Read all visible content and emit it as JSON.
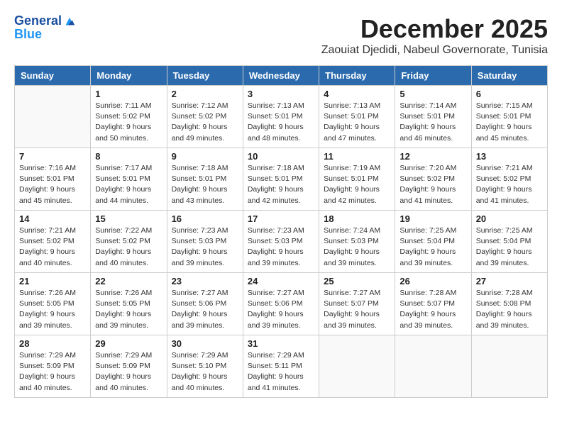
{
  "logo": {
    "general": "General",
    "blue": "Blue"
  },
  "header": {
    "month_year": "December 2025",
    "location": "Zaouiat Djedidi, Nabeul Governorate, Tunisia"
  },
  "columns": [
    "Sunday",
    "Monday",
    "Tuesday",
    "Wednesday",
    "Thursday",
    "Friday",
    "Saturday"
  ],
  "weeks": [
    [
      {
        "day": "",
        "sunrise": "",
        "sunset": "",
        "daylight": ""
      },
      {
        "day": "1",
        "sunrise": "Sunrise: 7:11 AM",
        "sunset": "Sunset: 5:02 PM",
        "daylight": "Daylight: 9 hours and 50 minutes."
      },
      {
        "day": "2",
        "sunrise": "Sunrise: 7:12 AM",
        "sunset": "Sunset: 5:02 PM",
        "daylight": "Daylight: 9 hours and 49 minutes."
      },
      {
        "day": "3",
        "sunrise": "Sunrise: 7:13 AM",
        "sunset": "Sunset: 5:01 PM",
        "daylight": "Daylight: 9 hours and 48 minutes."
      },
      {
        "day": "4",
        "sunrise": "Sunrise: 7:13 AM",
        "sunset": "Sunset: 5:01 PM",
        "daylight": "Daylight: 9 hours and 47 minutes."
      },
      {
        "day": "5",
        "sunrise": "Sunrise: 7:14 AM",
        "sunset": "Sunset: 5:01 PM",
        "daylight": "Daylight: 9 hours and 46 minutes."
      },
      {
        "day": "6",
        "sunrise": "Sunrise: 7:15 AM",
        "sunset": "Sunset: 5:01 PM",
        "daylight": "Daylight: 9 hours and 45 minutes."
      }
    ],
    [
      {
        "day": "7",
        "sunrise": "Sunrise: 7:16 AM",
        "sunset": "Sunset: 5:01 PM",
        "daylight": "Daylight: 9 hours and 45 minutes."
      },
      {
        "day": "8",
        "sunrise": "Sunrise: 7:17 AM",
        "sunset": "Sunset: 5:01 PM",
        "daylight": "Daylight: 9 hours and 44 minutes."
      },
      {
        "day": "9",
        "sunrise": "Sunrise: 7:18 AM",
        "sunset": "Sunset: 5:01 PM",
        "daylight": "Daylight: 9 hours and 43 minutes."
      },
      {
        "day": "10",
        "sunrise": "Sunrise: 7:18 AM",
        "sunset": "Sunset: 5:01 PM",
        "daylight": "Daylight: 9 hours and 42 minutes."
      },
      {
        "day": "11",
        "sunrise": "Sunrise: 7:19 AM",
        "sunset": "Sunset: 5:01 PM",
        "daylight": "Daylight: 9 hours and 42 minutes."
      },
      {
        "day": "12",
        "sunrise": "Sunrise: 7:20 AM",
        "sunset": "Sunset: 5:02 PM",
        "daylight": "Daylight: 9 hours and 41 minutes."
      },
      {
        "day": "13",
        "sunrise": "Sunrise: 7:21 AM",
        "sunset": "Sunset: 5:02 PM",
        "daylight": "Daylight: 9 hours and 41 minutes."
      }
    ],
    [
      {
        "day": "14",
        "sunrise": "Sunrise: 7:21 AM",
        "sunset": "Sunset: 5:02 PM",
        "daylight": "Daylight: 9 hours and 40 minutes."
      },
      {
        "day": "15",
        "sunrise": "Sunrise: 7:22 AM",
        "sunset": "Sunset: 5:02 PM",
        "daylight": "Daylight: 9 hours and 40 minutes."
      },
      {
        "day": "16",
        "sunrise": "Sunrise: 7:23 AM",
        "sunset": "Sunset: 5:03 PM",
        "daylight": "Daylight: 9 hours and 39 minutes."
      },
      {
        "day": "17",
        "sunrise": "Sunrise: 7:23 AM",
        "sunset": "Sunset: 5:03 PM",
        "daylight": "Daylight: 9 hours and 39 minutes."
      },
      {
        "day": "18",
        "sunrise": "Sunrise: 7:24 AM",
        "sunset": "Sunset: 5:03 PM",
        "daylight": "Daylight: 9 hours and 39 minutes."
      },
      {
        "day": "19",
        "sunrise": "Sunrise: 7:25 AM",
        "sunset": "Sunset: 5:04 PM",
        "daylight": "Daylight: 9 hours and 39 minutes."
      },
      {
        "day": "20",
        "sunrise": "Sunrise: 7:25 AM",
        "sunset": "Sunset: 5:04 PM",
        "daylight": "Daylight: 9 hours and 39 minutes."
      }
    ],
    [
      {
        "day": "21",
        "sunrise": "Sunrise: 7:26 AM",
        "sunset": "Sunset: 5:05 PM",
        "daylight": "Daylight: 9 hours and 39 minutes."
      },
      {
        "day": "22",
        "sunrise": "Sunrise: 7:26 AM",
        "sunset": "Sunset: 5:05 PM",
        "daylight": "Daylight: 9 hours and 39 minutes."
      },
      {
        "day": "23",
        "sunrise": "Sunrise: 7:27 AM",
        "sunset": "Sunset: 5:06 PM",
        "daylight": "Daylight: 9 hours and 39 minutes."
      },
      {
        "day": "24",
        "sunrise": "Sunrise: 7:27 AM",
        "sunset": "Sunset: 5:06 PM",
        "daylight": "Daylight: 9 hours and 39 minutes."
      },
      {
        "day": "25",
        "sunrise": "Sunrise: 7:27 AM",
        "sunset": "Sunset: 5:07 PM",
        "daylight": "Daylight: 9 hours and 39 minutes."
      },
      {
        "day": "26",
        "sunrise": "Sunrise: 7:28 AM",
        "sunset": "Sunset: 5:07 PM",
        "daylight": "Daylight: 9 hours and 39 minutes."
      },
      {
        "day": "27",
        "sunrise": "Sunrise: 7:28 AM",
        "sunset": "Sunset: 5:08 PM",
        "daylight": "Daylight: 9 hours and 39 minutes."
      }
    ],
    [
      {
        "day": "28",
        "sunrise": "Sunrise: 7:29 AM",
        "sunset": "Sunset: 5:09 PM",
        "daylight": "Daylight: 9 hours and 40 minutes."
      },
      {
        "day": "29",
        "sunrise": "Sunrise: 7:29 AM",
        "sunset": "Sunset: 5:09 PM",
        "daylight": "Daylight: 9 hours and 40 minutes."
      },
      {
        "day": "30",
        "sunrise": "Sunrise: 7:29 AM",
        "sunset": "Sunset: 5:10 PM",
        "daylight": "Daylight: 9 hours and 40 minutes."
      },
      {
        "day": "31",
        "sunrise": "Sunrise: 7:29 AM",
        "sunset": "Sunset: 5:11 PM",
        "daylight": "Daylight: 9 hours and 41 minutes."
      },
      {
        "day": "",
        "sunrise": "",
        "sunset": "",
        "daylight": ""
      },
      {
        "day": "",
        "sunrise": "",
        "sunset": "",
        "daylight": ""
      },
      {
        "day": "",
        "sunrise": "",
        "sunset": "",
        "daylight": ""
      }
    ]
  ]
}
